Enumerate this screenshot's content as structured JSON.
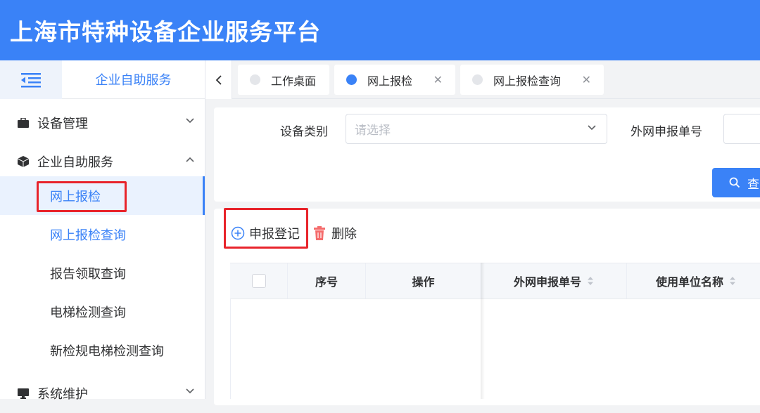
{
  "header": {
    "title": "上海市特种设备企业服务平台"
  },
  "sidebar": {
    "section_title": "企业自助服务",
    "groups": [
      {
        "label": "设备管理",
        "icon": "briefcase-icon",
        "expanded": false
      },
      {
        "label": "企业自助服务",
        "icon": "cube-icon",
        "expanded": true
      },
      {
        "label": "系统维护",
        "icon": "monitor-icon",
        "expanded": false
      }
    ],
    "items": [
      {
        "label": "网上报检",
        "active": true
      },
      {
        "label": "网上报检查询"
      },
      {
        "label": "报告领取查询"
      },
      {
        "label": "电梯检测查询"
      },
      {
        "label": "新检规电梯检测查询"
      }
    ]
  },
  "tabs": [
    {
      "label": "工作桌面",
      "active": false,
      "closable": false
    },
    {
      "label": "网上报检",
      "active": true,
      "closable": true
    },
    {
      "label": "网上报检查询",
      "active": false,
      "closable": true
    }
  ],
  "filters": {
    "device_type_label": "设备类别",
    "device_type_placeholder": "请选择",
    "report_no_label": "外网申报单号",
    "search_label": "查"
  },
  "toolbar": {
    "add_label": "申报登记",
    "delete_label": "删除"
  },
  "table": {
    "columns": [
      "序号",
      "操作",
      "外网申报单号",
      "使用单位名称"
    ],
    "rows": []
  },
  "colors": {
    "primary": "#3a82f7",
    "highlight": "#e8242b",
    "danger": "#f56c6c"
  }
}
